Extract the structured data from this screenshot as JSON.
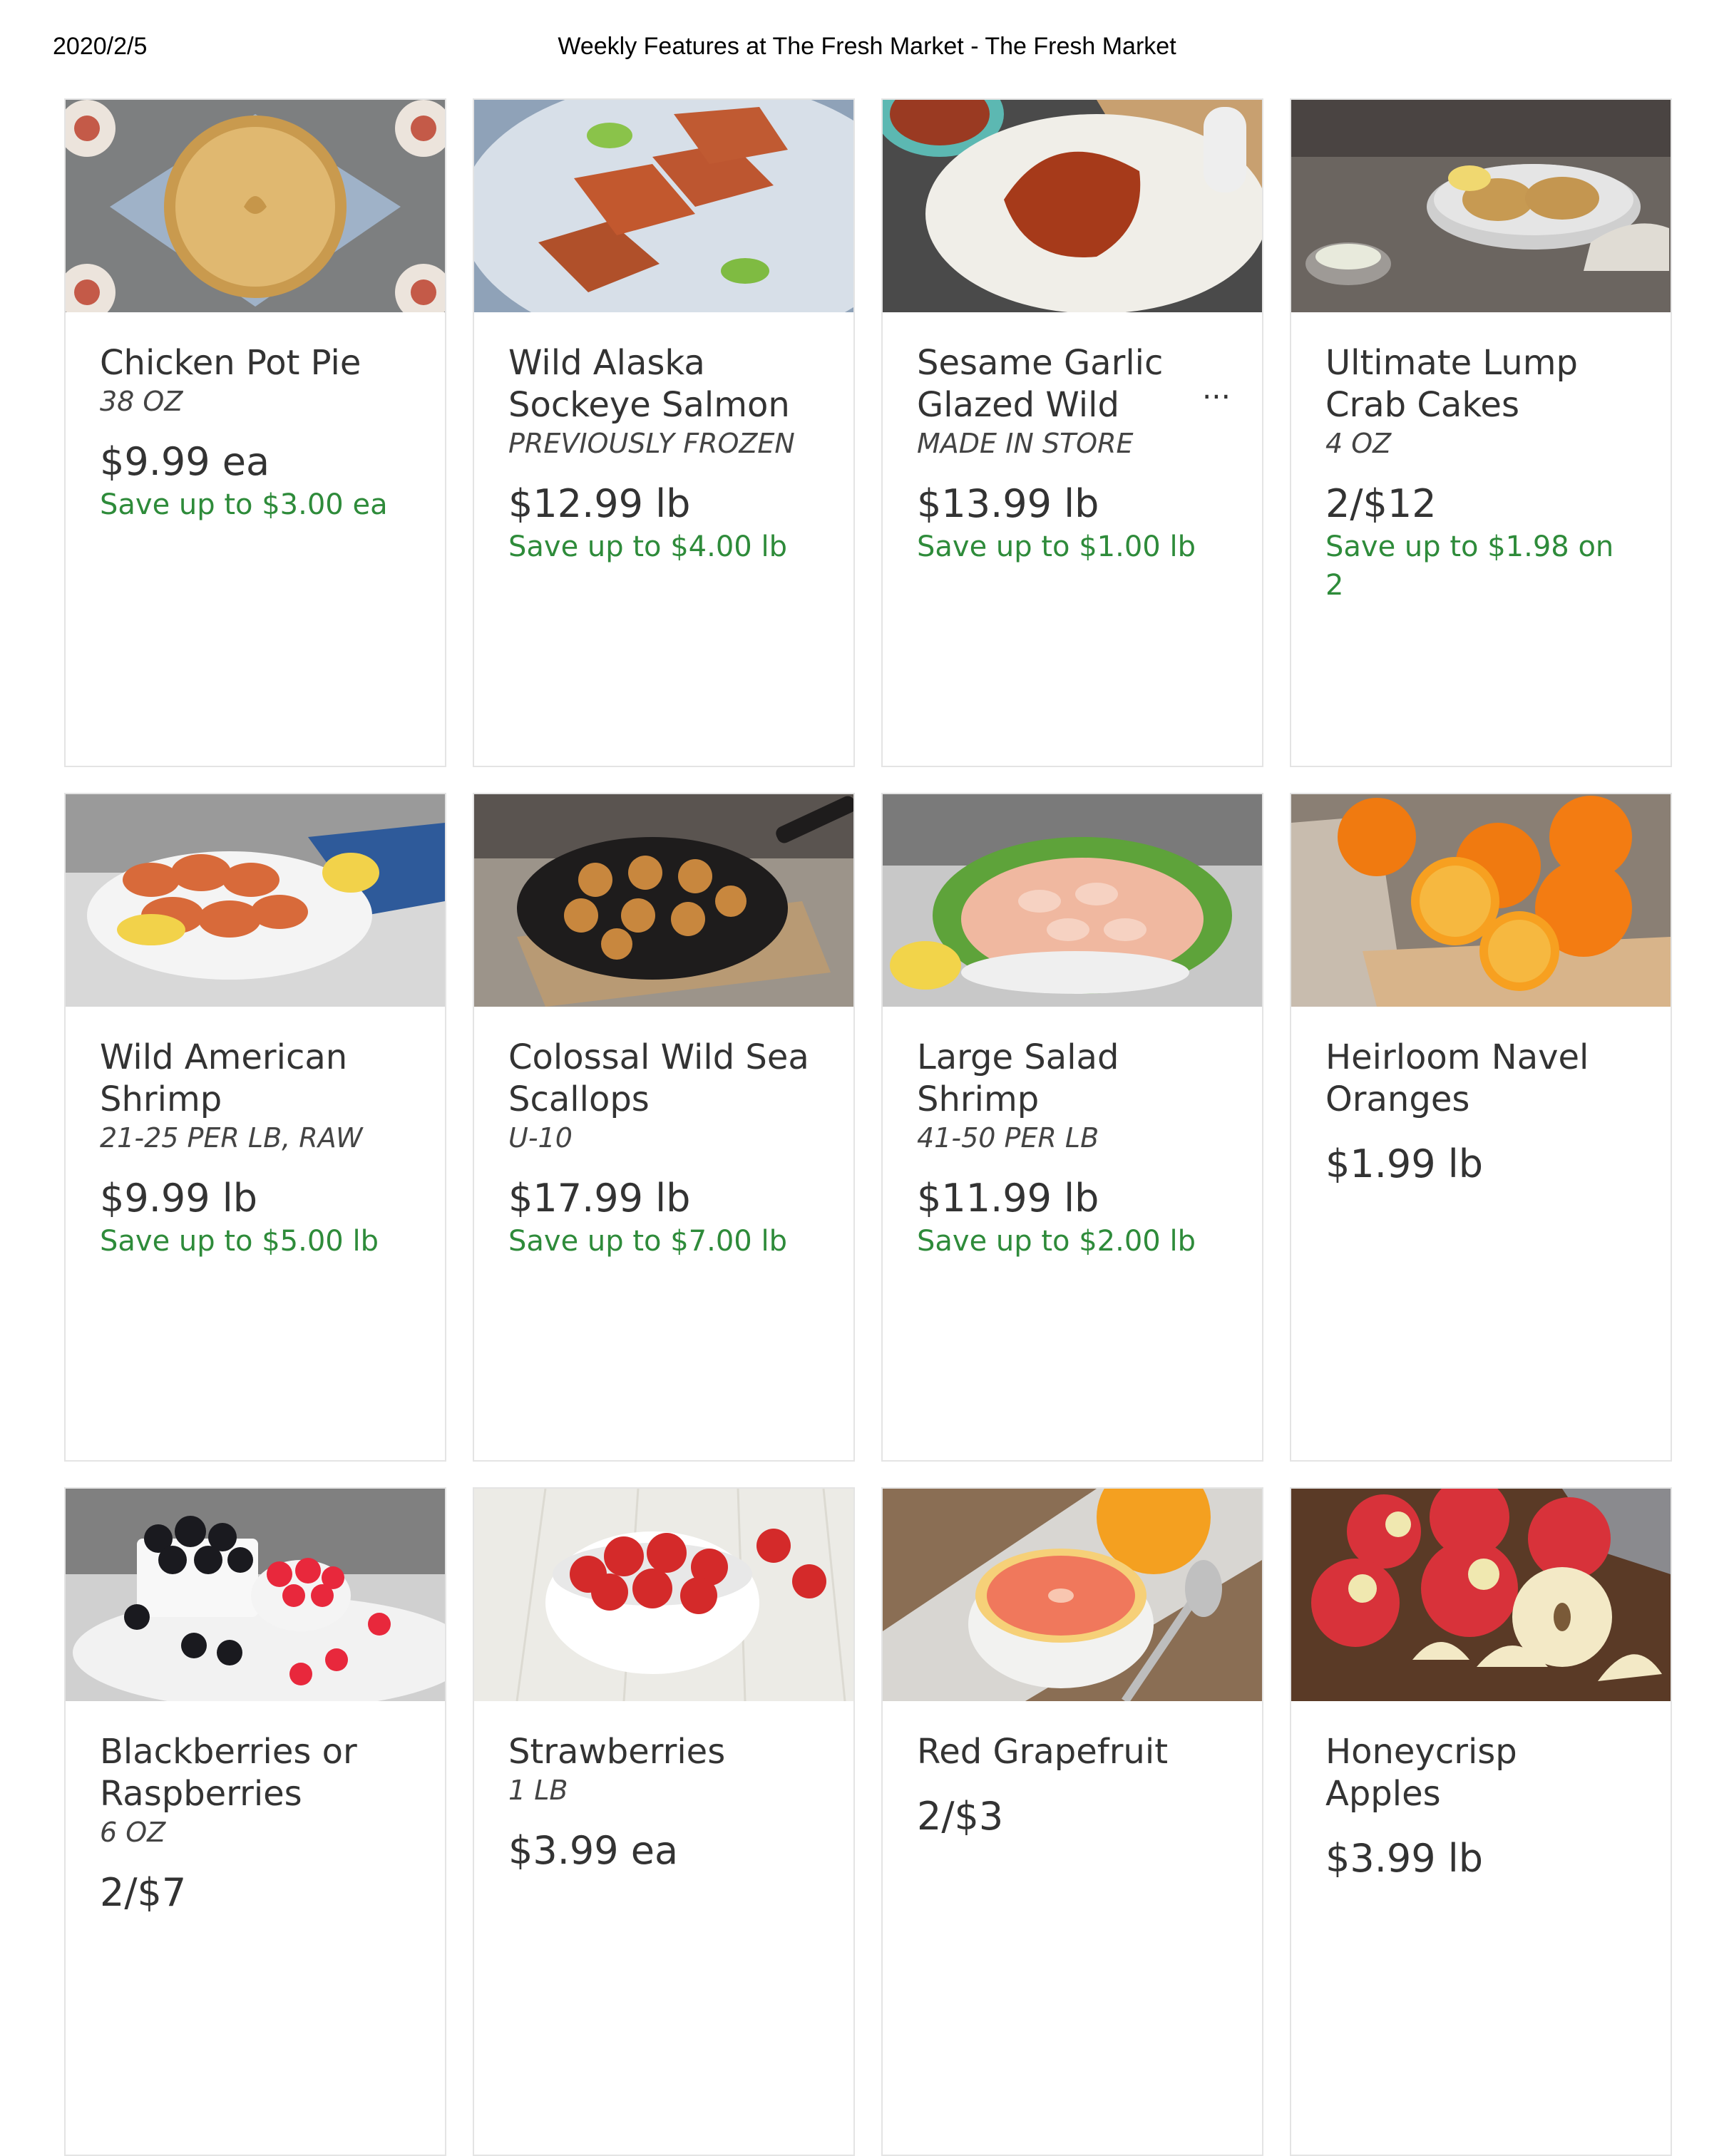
{
  "print_header": {
    "date": "2020/2/5",
    "title": "Weekly Features at The Fresh Market - The Fresh Market"
  },
  "colors": {
    "save_green": "#2e8b3a",
    "text": "#333333",
    "card_border": "#e4e4e4"
  },
  "products": [
    {
      "name": "Chicken Pot Pie",
      "size": "38 OZ",
      "price": "$9.99 ea",
      "save": "Save up to $3.00 ea",
      "image": "chicken-pot-pie-image"
    },
    {
      "name": "Wild Alaska Sockeye Salmon",
      "size": "PREVIOUSLY FROZEN",
      "price": "$12.99 lb",
      "save": "Save up to $4.00 lb",
      "image": "salmon-image"
    },
    {
      "name": "Sesame Garlic Glazed Wild",
      "size": "MADE IN STORE",
      "price": "$13.99 lb",
      "save": "Save up to $1.00 lb",
      "more": "...",
      "image": "glazed-fish-image"
    },
    {
      "name": "Ultimate Lump Crab Cakes",
      "size": "4 OZ",
      "price": "2/$12",
      "save": "Save up to $1.98 on 2",
      "image": "crab-cakes-image"
    },
    {
      "name": "Wild American Shrimp",
      "size": "21-25 PER LB, RAW",
      "price": "$9.99 lb",
      "save": "Save up to $5.00 lb",
      "image": "shrimp-image"
    },
    {
      "name": "Colossal Wild Sea Scallops",
      "size": "U-10",
      "price": "$17.99 lb",
      "save": "Save up to $7.00 lb",
      "image": "scallops-image"
    },
    {
      "name": "Large Salad Shrimp",
      "size": "41-50 PER LB",
      "price": "$11.99 lb",
      "save": "Save up to $2.00 lb",
      "image": "salad-shrimp-image"
    },
    {
      "name": "Heirloom Navel Oranges",
      "size": "",
      "price": "$1.99 lb",
      "save": "",
      "image": "oranges-image"
    },
    {
      "name": "Blackberries or Raspberries",
      "size": "6 OZ",
      "price": "2/$7",
      "save": "",
      "image": "berries-image"
    },
    {
      "name": "Strawberries",
      "size": "1 LB",
      "price": "$3.99 ea",
      "save": "",
      "image": "strawberries-image"
    },
    {
      "name": "Red Grapefruit",
      "size": "",
      "price": "2/$3",
      "save": "",
      "image": "grapefruit-image"
    },
    {
      "name": "Honeycrisp Apples",
      "size": "",
      "price": "$3.99 lb",
      "save": "",
      "image": "apples-image"
    }
  ]
}
